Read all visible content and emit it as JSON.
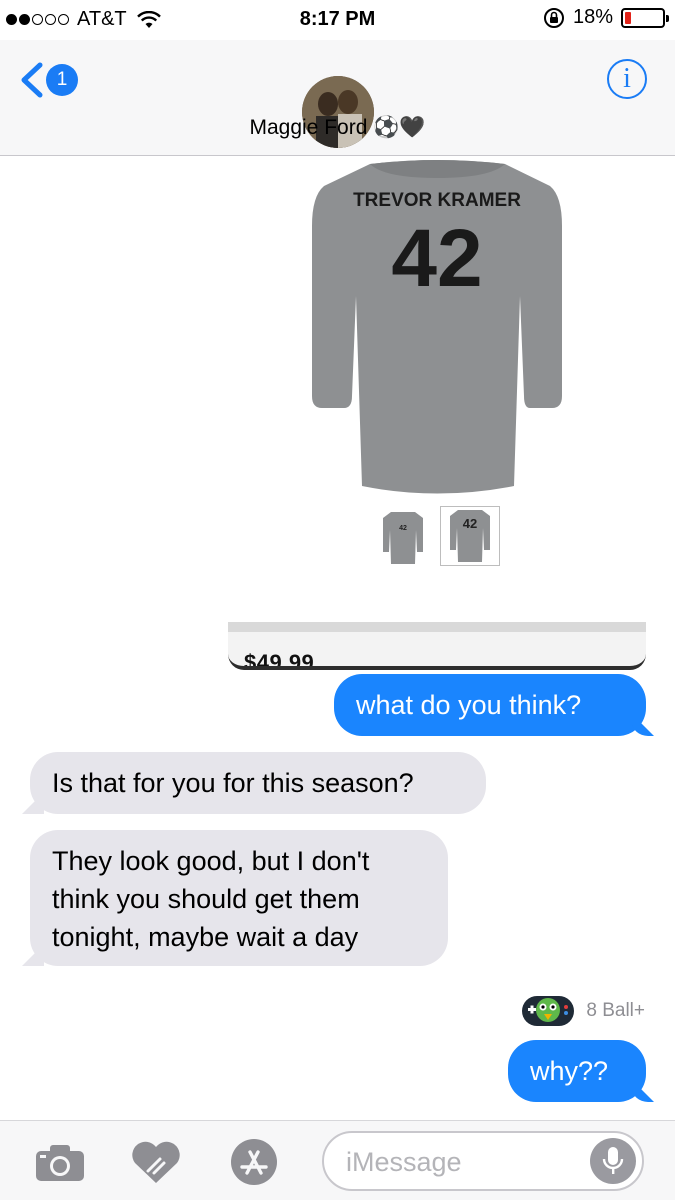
{
  "status_bar": {
    "carrier": "AT&T",
    "time": "8:17 PM",
    "battery_percent": "18%",
    "battery_level": 0.18,
    "battery_color": "#e2231a",
    "signal_bars_filled": 2,
    "signal_bars_total": 5
  },
  "header": {
    "back_badge": "1",
    "contact_name": "Maggie Ford ⚽🖤",
    "info_label": "i"
  },
  "product": {
    "shirt_name": "TREVOR KRAMER",
    "shirt_number": "42",
    "thumb_number": "42",
    "price": "$49.99"
  },
  "messages": {
    "m1": "what do you think?",
    "m2": "Is that for you for this season?",
    "m3_line1": "They look good, but I don't",
    "m3_line2": "think you should get them",
    "m3_line3": "tonight, maybe wait a day",
    "extension_label": "8 Ball+",
    "m4": "why??"
  },
  "composer": {
    "placeholder": "iMessage",
    "icons": [
      "camera-icon",
      "digital-touch-icon",
      "app-store-icon",
      "microphone-icon"
    ]
  },
  "colors": {
    "accent": "#1a7cf5",
    "outgoing_bubble": "#1a85fe",
    "incoming_bubble": "#e6e5eb",
    "shirt": "#8e9092"
  }
}
